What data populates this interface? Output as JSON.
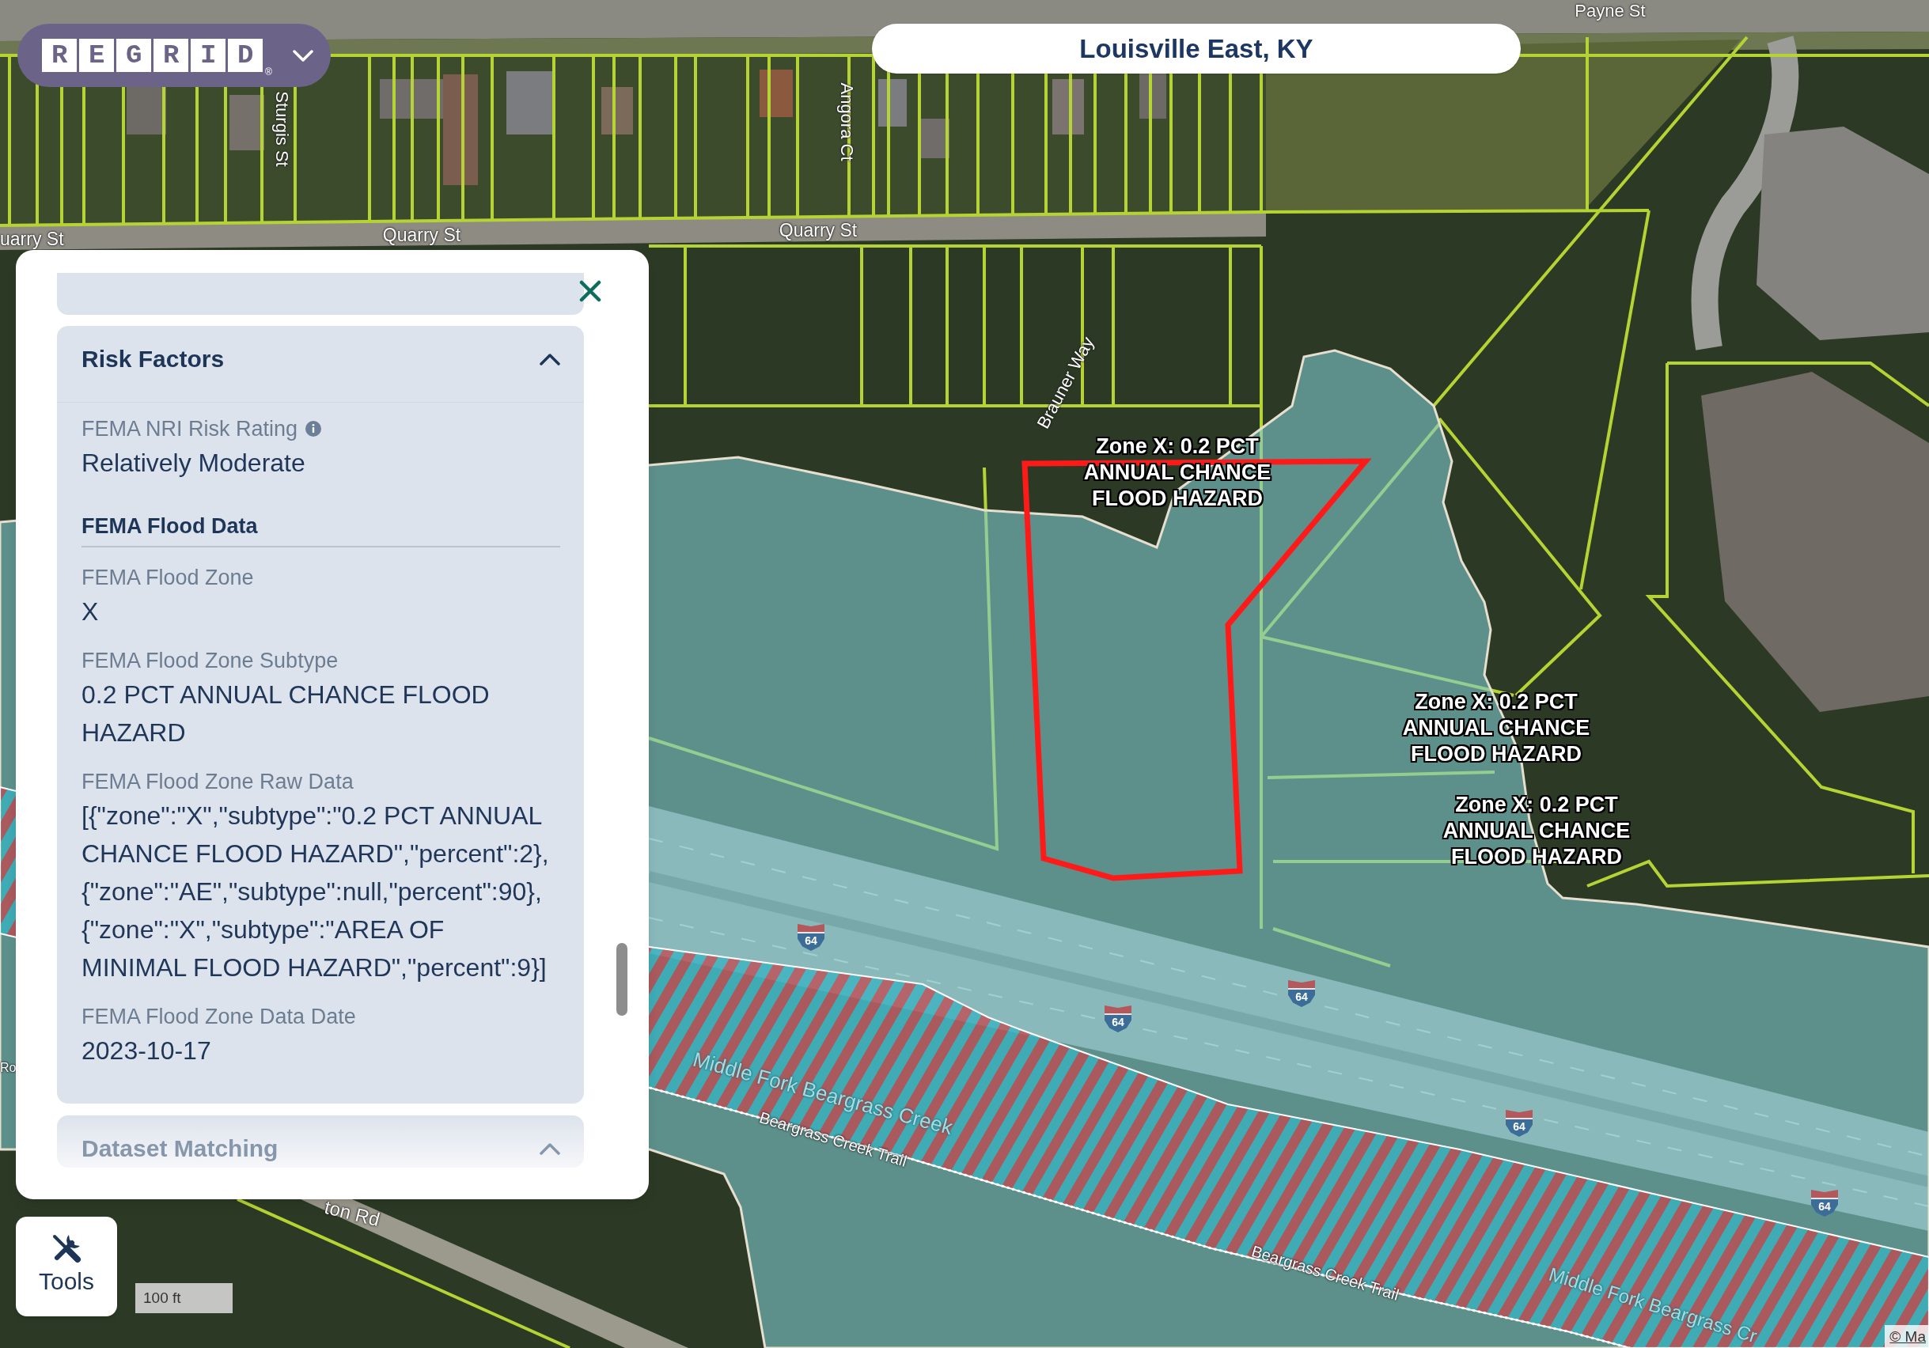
{
  "logo": {
    "letters": "REGRID",
    "mark": "®"
  },
  "location_title": "Louisville East, KY",
  "map": {
    "labels": [
      {
        "text": "Payne St",
        "kind": "street"
      },
      {
        "text": "Sturgis St",
        "kind": "street"
      },
      {
        "text": "Angora Ct",
        "kind": "street"
      },
      {
        "text": "uarry St",
        "kind": "street"
      },
      {
        "text": "Quarry St",
        "kind": "street"
      },
      {
        "text": "Quarry St",
        "kind": "street"
      },
      {
        "text": "Brauner Way",
        "kind": "street"
      },
      {
        "text": "Ro",
        "kind": "street"
      },
      {
        "text": "Middle Fork Beargrass Creek",
        "kind": "waterway"
      },
      {
        "text": "Beargrass Creek Trail",
        "kind": "trail"
      },
      {
        "text": "ton Rd",
        "kind": "street"
      },
      {
        "text": "Beargrass Creek Trail",
        "kind": "trail"
      },
      {
        "text": "Middle Fork Beargrass Cr",
        "kind": "waterway"
      }
    ],
    "zone_labels": [
      "Zone X: 0.2 PCT ANNUAL CHANCE FLOOD HAZARD",
      "Zone X: 0.2 PCT ANNUAL CHANCE FLOOD HAZARD",
      "Zone X: 0.2 PCT ANNUAL CHANCE FLOOD HAZARD"
    ],
    "route_shields": [
      "64",
      "64",
      "64",
      "64",
      "64"
    ],
    "scale_bar": "100 ft",
    "attribution": "© Ma"
  },
  "panel": {
    "sections": [
      {
        "title": "Risk Factors",
        "expanded": true,
        "items": [
          {
            "kind": "field",
            "label": "FEMA NRI Risk Rating",
            "info": true,
            "value": "Relatively Moderate"
          },
          {
            "kind": "heading",
            "label": "FEMA Flood Data"
          },
          {
            "kind": "field",
            "label": "FEMA Flood Zone",
            "value": "X"
          },
          {
            "kind": "field",
            "label": "FEMA Flood Zone Subtype",
            "value": "0.2 PCT ANNUAL CHANCE FLOOD HAZARD"
          },
          {
            "kind": "field",
            "label": "FEMA Flood Zone Raw Data",
            "value": "[{\"zone\":\"X\",\"subtype\":\"0.2 PCT ANNUAL CHANCE FLOOD HAZARD\",\"percent\":2},{\"zone\":\"AE\",\"subtype\":null,\"percent\":90},{\"zone\":\"X\",\"subtype\":\"AREA OF MINIMAL FLOOD HAZARD\",\"percent\":9}]"
          },
          {
            "kind": "field",
            "label": "FEMA Flood Zone Data Date",
            "value": "2023-10-17"
          }
        ]
      },
      {
        "title": "Dataset Matching",
        "expanded": true
      }
    ]
  },
  "tools_button": {
    "label": "Tools"
  }
}
